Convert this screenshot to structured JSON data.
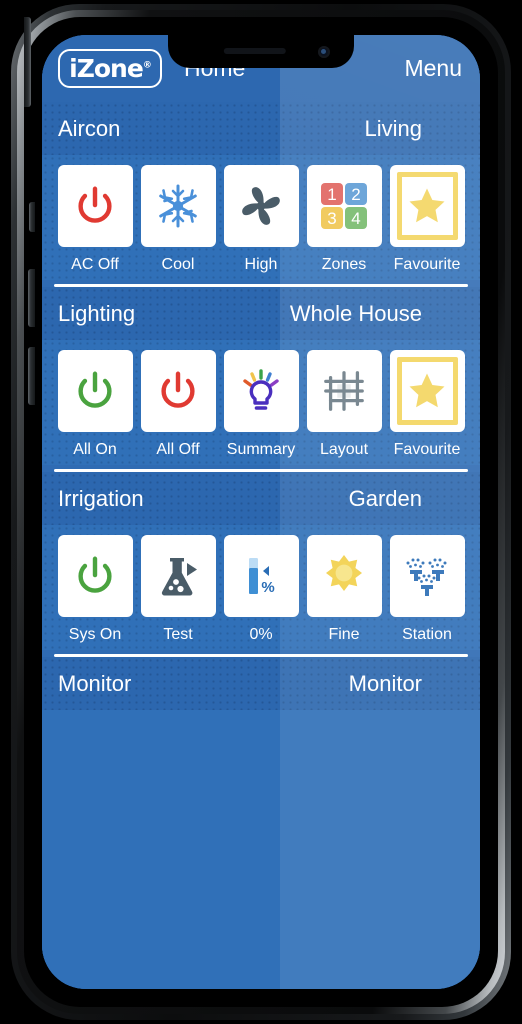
{
  "header": {
    "logo_text": "iZone",
    "logo_mark": "registered-mark",
    "title": "Home",
    "menu_label": "Menu"
  },
  "sections": [
    {
      "name": "Aircon",
      "location": "Living",
      "tiles": [
        {
          "label": "AC Off",
          "icon": "power-icon",
          "color": "#e03a32"
        },
        {
          "label": "Cool",
          "icon": "snowflake-icon",
          "color": "#4a90d9"
        },
        {
          "label": "High",
          "icon": "fan-icon",
          "color": "#4a5c68"
        },
        {
          "label": "Zones",
          "icon": "zones-icon",
          "color": "#4a90d9"
        },
        {
          "label": "Favourite",
          "icon": "star-icon",
          "color": "#f3d55e"
        }
      ]
    },
    {
      "name": "Lighting",
      "location": "Whole House",
      "tiles": [
        {
          "label": "All On",
          "icon": "power-icon",
          "color": "#4aa33f"
        },
        {
          "label": "All Off",
          "icon": "power-icon",
          "color": "#e03a32"
        },
        {
          "label": "Summary",
          "icon": "lightbulb-icon",
          "color": "#4a2fbe"
        },
        {
          "label": "Layout",
          "icon": "grid-icon",
          "color": "#6b7b85"
        },
        {
          "label": "Favourite",
          "icon": "star-icon",
          "color": "#f3d55e"
        }
      ]
    },
    {
      "name": "Irrigation",
      "location": "Garden",
      "tiles": [
        {
          "label": "Sys On",
          "icon": "power-icon",
          "color": "#4aa33f"
        },
        {
          "label": "Test",
          "icon": "flask-icon",
          "color": "#4a5c68"
        },
        {
          "label": "0%",
          "icon": "gauge-icon",
          "color": "#3f8fd4"
        },
        {
          "label": "Fine",
          "icon": "sun-icon",
          "color": "#f2d04a"
        },
        {
          "label": "Station",
          "icon": "sprinkler-icon",
          "color": "#2a6db5"
        }
      ]
    },
    {
      "name": "Monitor",
      "location": "Monitor",
      "tiles": []
    }
  ],
  "colors": {
    "app_background": "#2f6bb3",
    "header_background": "#2d68b0",
    "tile_background": "#ffffff",
    "text": "#ffffff",
    "zone_1": "#e0615b",
    "zone_2": "#5b9bd5",
    "zone_3": "#f0c44c",
    "zone_4": "#74b96a"
  },
  "zones": [
    "1",
    "2",
    "3",
    "4"
  ]
}
